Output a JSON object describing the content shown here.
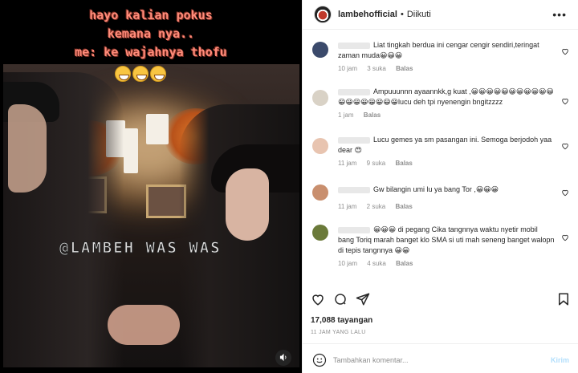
{
  "media": {
    "caption_lines": [
      "hayo kalian pokus",
      "kemana nya..",
      "me: ke wajahnya thofu"
    ],
    "watermark": "@LAMBEH WAS WAS",
    "mute_icon": "speaker-icon"
  },
  "header": {
    "username": "lambehofficial",
    "separator": "•",
    "follow_status": "Diikuti",
    "more_icon": "more-horizontal-icon"
  },
  "comments": [
    {
      "text": "Liat tingkah berdua ini cengar cengir sendiri,teringat zaman muda😀😀😀",
      "time": "10 jam",
      "likes": "3 suka",
      "reply": "Balas",
      "avatar_color": "#3b4a6b"
    },
    {
      "text": "Ampuuunnn ayaannkk,g kuat ,😀😀😀😀😀😀😀😀😀😀😀😀😀😀😀😀😀😀😀lucu deh tpi nyenengin bngitzzzz",
      "time": "1 jam",
      "likes": "",
      "reply": "Balas",
      "avatar_color": "#d9d2c6"
    },
    {
      "text": "Lucu gemes ya sm pasangan ini. Semoga berjodoh yaa dear 😍",
      "time": "11 jam",
      "likes": "9 suka",
      "reply": "Balas",
      "avatar_color": "#e8c4b0"
    },
    {
      "text": "Gw bilangin umi lu ya bang Tor ,😀😀😀",
      "time": "11 jam",
      "likes": "2 suka",
      "reply": "Balas",
      "avatar_color": "#c98f6e"
    },
    {
      "text": "😀😀😀 di pegang Cika tangnnya waktu nyetir mobil bang Toriq marah banget klo SMA si uti mah seneng banget walopn di tepis tangnnya 😀😀",
      "time": "10 jam",
      "likes": "4 suka",
      "reply": "Balas",
      "avatar_color": "#6b7a3a"
    }
  ],
  "actions": {
    "like_icon": "heart-icon",
    "comment_icon": "comment-icon",
    "share_icon": "share-icon",
    "save_icon": "bookmark-icon"
  },
  "views": "17,088 tayangan",
  "posted_time": "11 JAM YANG LALU",
  "add_comment": {
    "placeholder": "Tambahkan komentar...",
    "send_label": "Kirim"
  }
}
